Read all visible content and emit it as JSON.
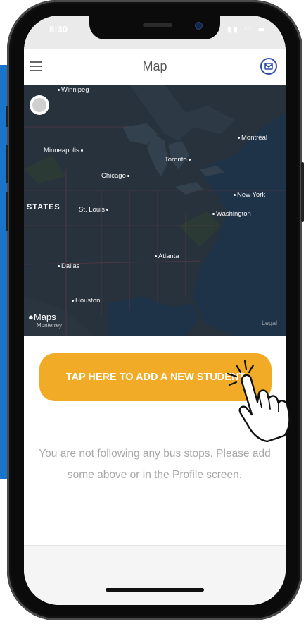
{
  "status_bar": {
    "time": "8:30",
    "icons": "▮▮ ◠ ▬"
  },
  "nav": {
    "title": "Map",
    "menu_icon": "hamburger-menu-icon",
    "mail_icon": "envelope-icon"
  },
  "map": {
    "labels": {
      "winnipeg": "Winnipeg",
      "montreal": "Montréal",
      "minneapolis": "Minneapolis",
      "toronto": "Toronto",
      "chicago": "Chicago",
      "new_york": "New York",
      "states": "STATES",
      "st_louis": "St. Louis",
      "washington": "Washington",
      "atlanta": "Atlanta",
      "dallas": "Dallas",
      "houston": "Houston",
      "monterrey": "Monterrey"
    },
    "attribution": "Maps",
    "legal": "Legal"
  },
  "add_student_button": "TAP HERE TO ADD A NEW STUDENT",
  "empty_message": "You are not following any bus stops. Please add some above or in the Profile screen.",
  "colors": {
    "accent_button": "#f2ab26",
    "side_strip": "#1a74c9",
    "map_background": "#25303b",
    "mail_icon": "#2e4da6"
  }
}
